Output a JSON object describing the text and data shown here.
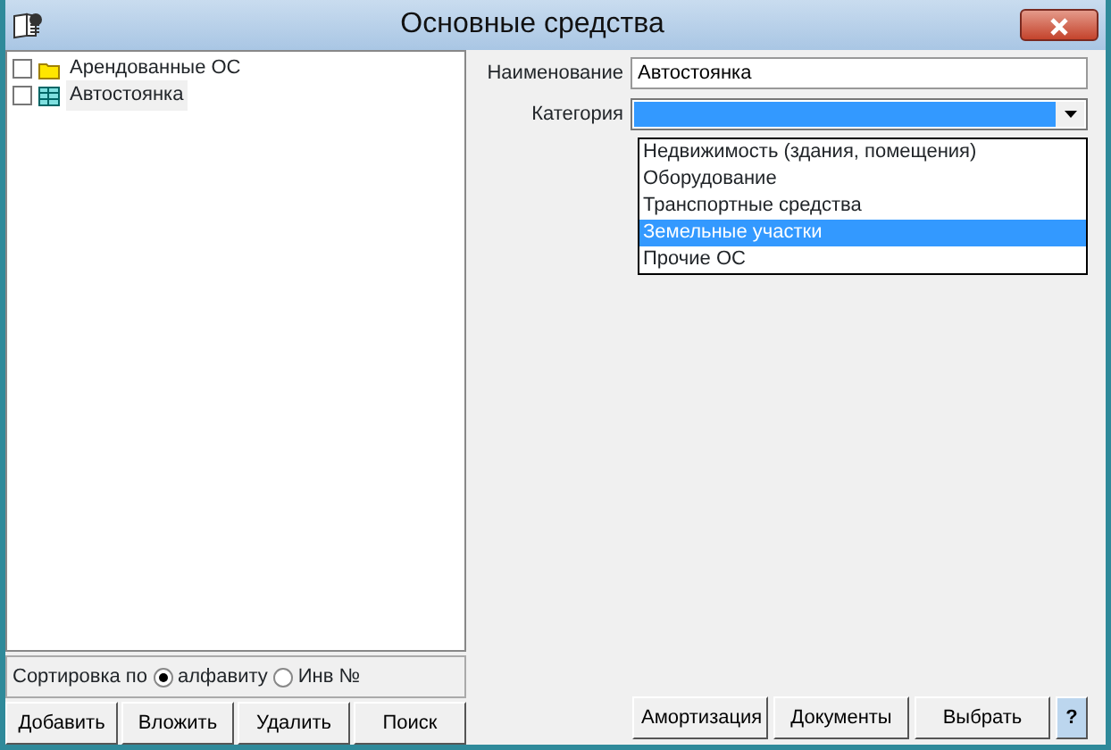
{
  "window": {
    "title": "Основные средства"
  },
  "tree": [
    {
      "label": "Арендованные ОС",
      "kind": "folder",
      "checked": false,
      "selected": false
    },
    {
      "label": "Автостоянка",
      "kind": "table",
      "checked": false,
      "selected": true
    }
  ],
  "sort": {
    "label": "Сортировка по",
    "options": [
      {
        "label": "алфавиту",
        "selected": true
      },
      {
        "label": "Инв №",
        "selected": false
      }
    ]
  },
  "left_buttons": [
    "Добавить",
    "Вложить",
    "Удалить",
    "Поиск"
  ],
  "form": {
    "name_label": "Наименование",
    "name_value": "Автостоянка",
    "category_label": "Категория",
    "options": [
      {
        "label": "Недвижимость (здания, помещения)",
        "selected": false
      },
      {
        "label": "Оборудование",
        "selected": false
      },
      {
        "label": "Транспортные средства",
        "selected": false
      },
      {
        "label": "Земельные участки",
        "selected": true
      },
      {
        "label": "Прочие ОС",
        "selected": false
      }
    ]
  },
  "right_buttons": [
    "Амортизация",
    "Документы",
    "Выбрать"
  ],
  "help_button": "?"
}
